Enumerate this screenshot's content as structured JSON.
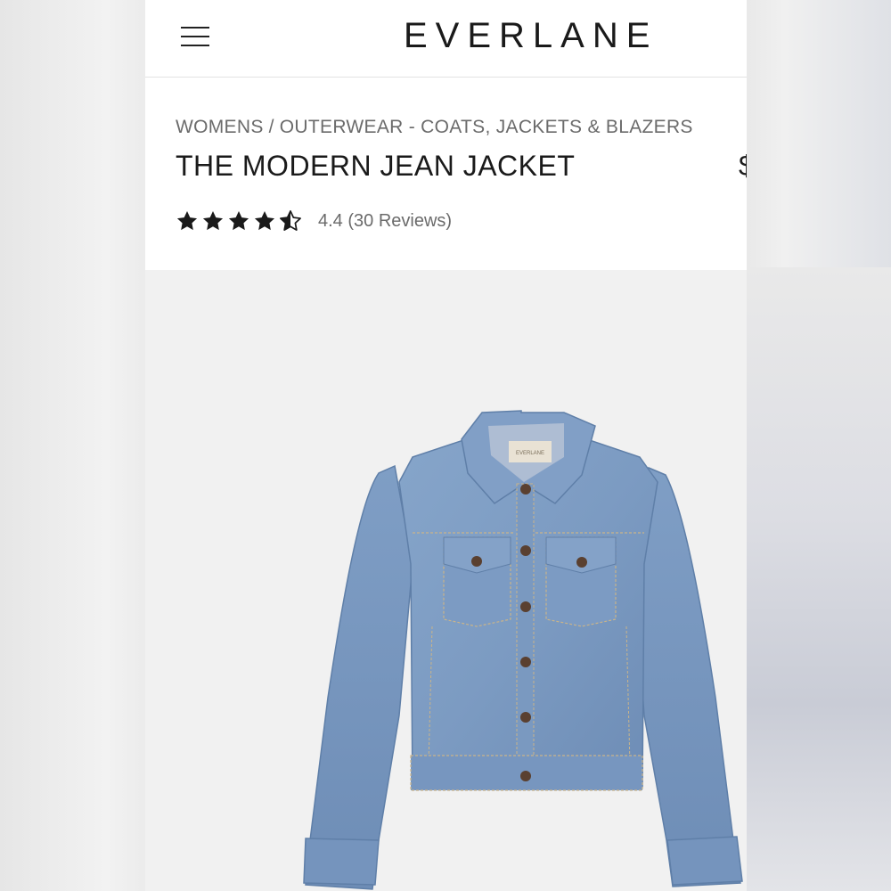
{
  "header": {
    "menu_icon": "hamburger-menu-icon",
    "logo": "EVERLANE"
  },
  "product": {
    "breadcrumb": [
      "WOMENS",
      "OUTERWEAR - COATS, JACKETS & BLAZERS"
    ],
    "breadcrumb_separator": "/",
    "title": "THE MODERN JEAN JACKET",
    "price_partial": "$",
    "rating": {
      "value": 4.4,
      "max": 5,
      "label": "4.4 (30 Reviews)"
    },
    "image": {
      "alt": "The Modern Jean Jacket in light blue denim",
      "label_text": "EVERLANE"
    }
  },
  "colors": {
    "denim": "#7d9dc4",
    "denim_dark": "#5f7fa8",
    "stitch": "#c9b48a",
    "button": "#5a4030",
    "star": "#1a1a1a",
    "text_muted": "#6b6b6b"
  }
}
